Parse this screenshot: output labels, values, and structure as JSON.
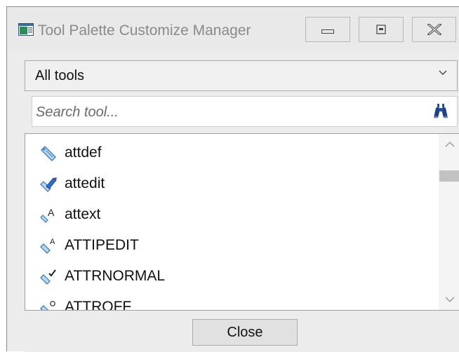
{
  "window": {
    "title": "Tool Palette Customize Manager",
    "controls": {
      "minimize": "minimize-icon",
      "maximize": "maximize-icon",
      "close": "close-icon"
    }
  },
  "filter": {
    "selected": "All tools"
  },
  "search": {
    "placeholder": "Search tool..."
  },
  "tools": [
    {
      "label": "attdef",
      "icon": "tag-icon"
    },
    {
      "label": "attedit",
      "icon": "tag-edit-icon"
    },
    {
      "label": "attext",
      "icon": "attribute-extract-icon"
    },
    {
      "label": "ATTIPEDIT",
      "icon": "tag-text-icon"
    },
    {
      "label": "ATTRNORMAL",
      "icon": "tag-check-icon"
    },
    {
      "label": "ATTROFF",
      "icon": "tag-off-icon"
    }
  ],
  "footer": {
    "close_label": "Close"
  },
  "colors": {
    "tag_blue": "#3b7fc4",
    "accent_dark": "#1f3f8c"
  }
}
